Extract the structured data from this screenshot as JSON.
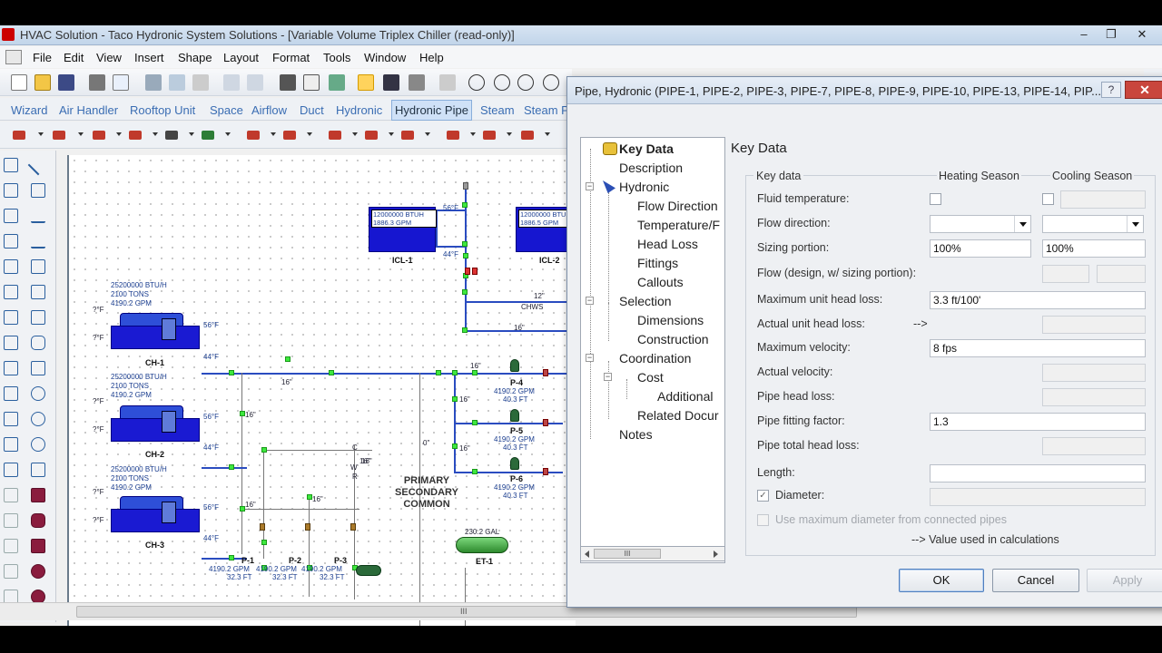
{
  "window": {
    "title": "HVAC Solution - Taco Hydronic System Solutions - [Variable Volume Triplex Chiller (read-only)]",
    "minimize": "–",
    "restore": "❐",
    "close": "✕"
  },
  "menu": [
    "File",
    "Edit",
    "View",
    "Insert",
    "Shape",
    "Layout",
    "Format",
    "Tools",
    "Window",
    "Help"
  ],
  "workspace_tabs": [
    "Wizard",
    "Air Handler",
    "Rooftop Unit",
    "Space",
    "Airflow",
    "Duct",
    "Hydronic",
    "Hydronic Pipe",
    "Steam",
    "Steam P"
  ],
  "active_tab": "Hydronic Pipe",
  "canvas": {
    "chillers": [
      {
        "name": "CH-1",
        "btuh": "25200000 BTU/H",
        "tons": "2100 TONS",
        "gpm": "4190.2 GPM"
      },
      {
        "name": "CH-2",
        "btuh": "25200000 BTU/H",
        "tons": "2100 TONS",
        "gpm": "4190.2 GPM"
      },
      {
        "name": "CH-3",
        "btuh": "25200000 BTU/H",
        "tons": "2100 TONS",
        "gpm": "4190.2 GPM"
      }
    ],
    "temp_56": "56°F",
    "temp_44": "44°F",
    "temp_unknown": "?°F",
    "loads": [
      {
        "name": "ICL-1",
        "btuh": "12000000 BTUH",
        "gpm": "1886.3 GPM"
      },
      {
        "name": "ICL-2",
        "btuh": "12000000 BTUH",
        "gpm": "1886.5 GPM"
      }
    ],
    "pipe_sizes": {
      "s16": "16\"",
      "s12": "12\"",
      "s0": "0\""
    },
    "chws": "CHWS",
    "wr": [
      "C",
      "W",
      "R"
    ],
    "secondary_pumps": [
      {
        "name": "P-4",
        "gpm": "4190.2 GPM",
        "ft": "40.3 FT"
      },
      {
        "name": "P-5",
        "gpm": "4190.2 GPM",
        "ft": "40.3 FT"
      },
      {
        "name": "P-6",
        "gpm": "4190.2 GPM",
        "ft": "40.3 FT"
      }
    ],
    "primary_pumps": [
      {
        "name": "P-1",
        "gpm": "4190.2 GPM",
        "ft": "32.3 FT"
      },
      {
        "name": "P-2",
        "gpm": "4190.2 GPM",
        "ft": "32.3 FT"
      },
      {
        "name": "P-3",
        "gpm": "4190.2 GPM",
        "ft": "32.3 FT"
      }
    ],
    "primary_common": [
      "PRIMARY",
      "SECONDARY",
      "COMMON"
    ],
    "exp_tank": {
      "name": "ET-1",
      "gal": "230.2 GAL"
    }
  },
  "dialog": {
    "title": "Pipe, Hydronic (PIPE-1, PIPE-2, PIPE-3, PIPE-7, PIPE-8, PIPE-9, PIPE-10, PIPE-13, PIPE-14, PIP...",
    "help": "?",
    "close": "✕",
    "tree": {
      "key_data": "Key Data",
      "description": "Description",
      "hydronic": "Hydronic",
      "flow_direction": "Flow Direction",
      "temperature": "Temperature/F",
      "head_loss": "Head Loss",
      "fittings": "Fittings",
      "callouts": "Callouts",
      "selection": "Selection",
      "dimensions": "Dimensions",
      "construction": "Construction",
      "coordination": "Coordination",
      "cost": "Cost",
      "additional": "Additional",
      "related_docs": "Related Docur",
      "notes": "Notes",
      "scroll_grip": "III"
    },
    "panel_title": "Key Data",
    "col_key": "Key data",
    "col_heating": "Heating Season",
    "col_cooling": "Cooling Season",
    "fields": {
      "fluid_temperature": "Fluid temperature:",
      "flow_direction": "Flow direction:",
      "sizing_portion": "Sizing portion:",
      "flow_design": "Flow (design, w/ sizing portion):",
      "max_unit_head_loss": "Maximum unit head loss:",
      "actual_unit_head_loss": "Actual unit head loss:",
      "max_velocity": "Maximum velocity:",
      "actual_velocity": "Actual velocity:",
      "pipe_head_loss": "Pipe head loss:",
      "pipe_fitting_factor": "Pipe fitting factor:",
      "pipe_total_head_loss": "Pipe total head loss:",
      "length": "Length:",
      "diameter": "Diameter:",
      "use_max_diameter": "Use maximum diameter from connected pipes"
    },
    "values": {
      "sizing_heating": "100%",
      "sizing_cooling": "100%",
      "max_unit_head_loss": "3.3 ft/100'",
      "max_velocity": "8 fps",
      "pipe_fitting_factor": "1.3"
    },
    "arrow": "-->",
    "footnote": "--> Value used in calculations",
    "check_mark": "✓",
    "buttons": {
      "ok": "OK",
      "cancel": "Cancel",
      "apply": "Apply"
    }
  },
  "hscroll_grip": "III"
}
